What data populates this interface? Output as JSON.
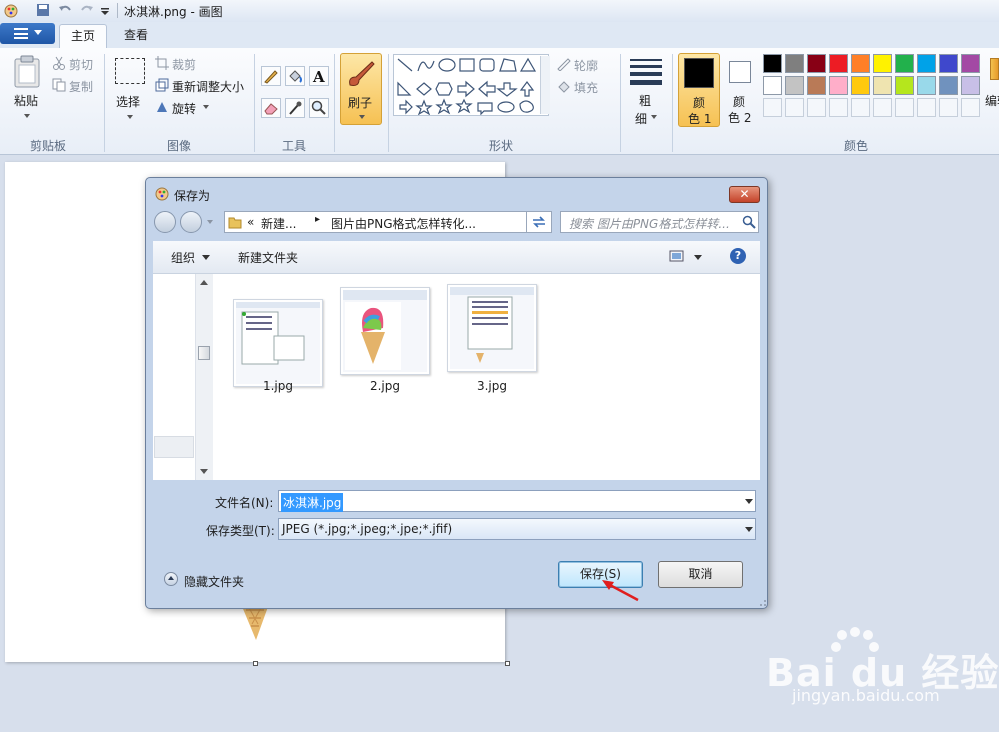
{
  "window": {
    "title": "冰淇淋.png - 画图"
  },
  "tabs": [
    {
      "label": "主页"
    },
    {
      "label": "查看"
    }
  ],
  "ribbon": {
    "clipboard": {
      "paste": "粘贴",
      "cut": "剪切",
      "copy": "复制",
      "group": "剪贴板"
    },
    "image": {
      "select": "选择",
      "crop": "裁剪",
      "resize": "重新调整大小",
      "rotate": "旋转",
      "group": "图像"
    },
    "tools": {
      "group": "工具"
    },
    "brush": {
      "label": "刷子"
    },
    "shapes": {
      "outline": "轮廓",
      "fill": "填充",
      "group": "形状"
    },
    "size": {
      "label1": "粗",
      "label2": "细"
    },
    "colors": {
      "color1": "颜",
      "color1b": "色 1",
      "color2": "颜",
      "color2b": "色 2",
      "edit": "编辑",
      "group": "颜色",
      "palette_row1": [
        "#000000",
        "#7f7f7f",
        "#880015",
        "#ed1c24",
        "#ff7f27",
        "#fff200",
        "#22b14c",
        "#00a2e8",
        "#3f48cc",
        "#a349a4"
      ],
      "palette_row2": [
        "#ffffff",
        "#c3c3c3",
        "#b97a57",
        "#ffaec9",
        "#ffc90e",
        "#efe4b0",
        "#b5e61d",
        "#99d9ea",
        "#7092be",
        "#c8bfe7"
      ],
      "primary": "#000000",
      "secondary": "#ffffff"
    }
  },
  "dialog": {
    "title": "保存为",
    "address": {
      "prefix": "«",
      "crumb1": "新建...",
      "crumb2": "图片由PNG格式怎样转化..."
    },
    "search_placeholder": "搜索 图片由PNG格式怎样转...",
    "toolbar": {
      "organize": "组织",
      "new_folder": "新建文件夹"
    },
    "files": [
      {
        "name": "1.jpg"
      },
      {
        "name": "2.jpg"
      },
      {
        "name": "3.jpg"
      }
    ],
    "filename_label": "文件名(N):",
    "filename_value": "冰淇淋.jpg",
    "filetype_label": "保存类型(T):",
    "filetype_value": "JPEG (*.jpg;*.jpeg;*.jpe;*.jfif)",
    "hide_folders": "隐藏文件夹",
    "save_button": "保存(S)",
    "cancel_button": "取消"
  },
  "watermark": {
    "brand": "Bai du 经验",
    "url": "jingyan.baidu.com"
  }
}
